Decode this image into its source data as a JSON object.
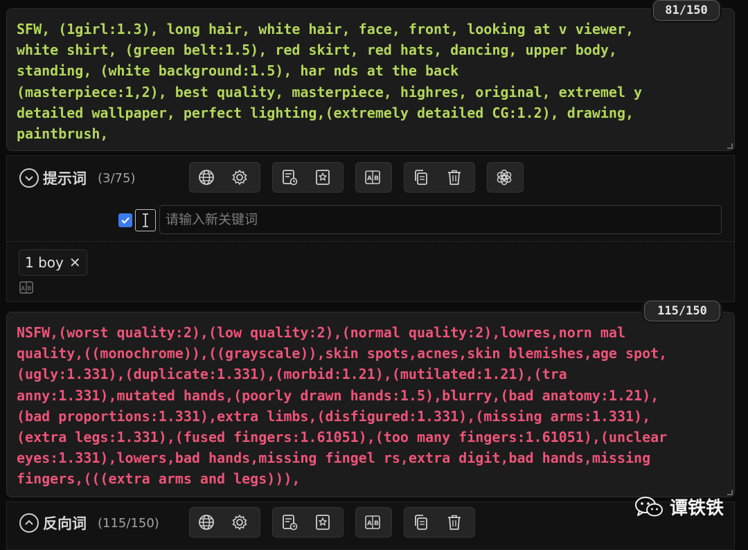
{
  "positive": {
    "counter": "81/150",
    "text": "SFW, (1girl:1.3), long hair, white hair, face, front, looking at v viewer,\nwhite shirt, (green belt:1.5), red skirt, red hats, dancing, upper body,\nstanding, (white background:1.5), har nds at the back\n(masterpiece:1,2), best quality, masterpiece, highres, original, extremel y\ndetailed wallpaper, perfect lighting,(extremely detailed CG:1.2), drawing,\npaintbrush,",
    "section_label": "提示词",
    "section_count": "(3/75)"
  },
  "keyword_input": {
    "placeholder": "请输入新关键词",
    "value": ""
  },
  "tags": [
    {
      "label": "1 boy"
    }
  ],
  "negative": {
    "counter": "115/150",
    "text": "NSFW,(worst quality:2),(low quality:2),(normal quality:2),lowres,norn mal\nquality,((monochrome)),((grayscale)),skin spots,acnes,skin blemishes,age spot,\n(ugly:1.331),(duplicate:1.331),(morbid:1.21),(mutilated:1.21),(tra\nanny:1.331),mutated hands,(poorly drawn hands:1.5),blurry,(bad anatomy:1.21),\n(bad proportions:1.331),extra limbs,(disfigured:1.331),(missing arms:1.331),\n(extra legs:1.331),(fused fingers:1.61051),(too many fingers:1.61051),(unclear\neyes:1.331),lowers,bad hands,missing fingel rs,extra digit,bad hands,missing\nfingers,(((extra arms and legs))),",
    "section_label": "反向词",
    "section_count": "(115/150)"
  },
  "watermark": {
    "text": "谭铁铁"
  },
  "icons": [
    "globe-icon",
    "gear-icon",
    "history-list-icon",
    "bookmark-star-icon",
    "translate-icon",
    "copy-icon",
    "trash-icon",
    "openai-icon"
  ],
  "colors": {
    "positive_text": "#b4d85a",
    "negative_text": "#ee5478",
    "checkbox": "#3a7bf0"
  }
}
